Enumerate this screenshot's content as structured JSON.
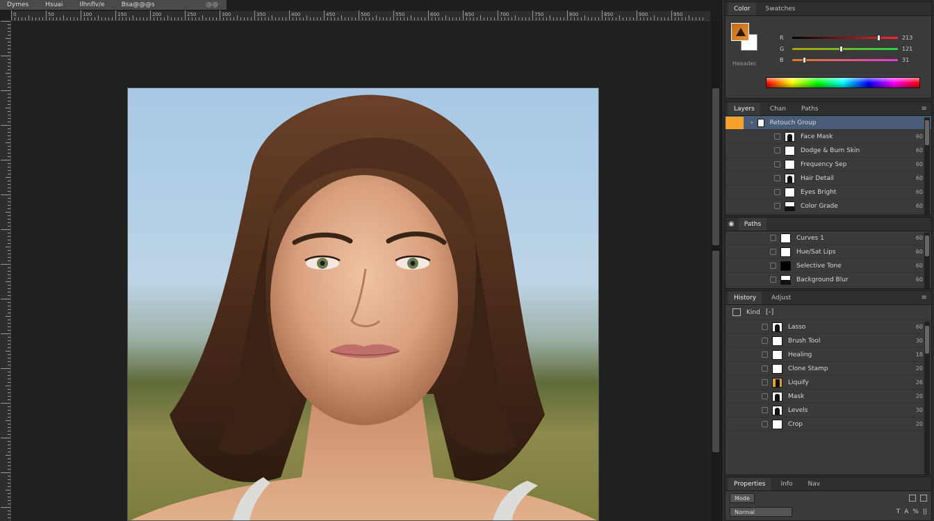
{
  "title_strip": {
    "items": [
      "Dymes",
      "Hsuai",
      "Ilhnflv/e",
      "Bsa@@@s"
    ],
    "close_label": "@@"
  },
  "ruler": {
    "top_labels": [
      "0",
      "50",
      "100",
      "150",
      "200",
      "250",
      "300",
      "350",
      "400",
      "450",
      "500",
      "550",
      "600",
      "650",
      "700",
      "750",
      "800",
      "850",
      "900",
      "950"
    ]
  },
  "color_panel": {
    "tabs": [
      "Color",
      "Swatches"
    ],
    "foreground_color": "#d5791f",
    "background_color": "#ffffff",
    "sliders": [
      {
        "label": "R",
        "value": "213",
        "level": 0.82
      },
      {
        "label": "G",
        "value": "121",
        "level": 0.47
      },
      {
        "label": "B",
        "value": "31",
        "level": 0.12
      }
    ],
    "status": "Hexadec"
  },
  "layers_panel_1": {
    "tabs": [
      "Layers",
      "Chan",
      "Paths"
    ],
    "group": {
      "name": "Retouch Group",
      "chip_color": "#f2a22d"
    },
    "rows": [
      {
        "name": "Face Mask",
        "opacity": "60",
        "thumb": "dark"
      },
      {
        "name": "Dodge & Burn Skin",
        "opacity": "60",
        "thumb": "white"
      },
      {
        "name": "Frequency Sep",
        "opacity": "60",
        "thumb": "white"
      },
      {
        "name": "Hair Detail",
        "opacity": "60",
        "thumb": "dark"
      },
      {
        "name": "Eyes Bright",
        "opacity": "60",
        "thumb": "white"
      },
      {
        "name": "Color Grade",
        "opacity": "60",
        "thumb": "half"
      }
    ]
  },
  "layers_panel_2": {
    "tabs": [
      "Paths"
    ],
    "rows": [
      {
        "name": "Curves 1",
        "opacity": "60",
        "thumb": "white"
      },
      {
        "name": "Hue/Sat Lips",
        "opacity": "60",
        "thumb": "white"
      },
      {
        "name": "Selective Tone",
        "opacity": "60",
        "thumb": "black"
      },
      {
        "name": "Background Blur",
        "opacity": "60",
        "thumb": "half"
      }
    ]
  },
  "layers_panel_3": {
    "tabs": [
      "History",
      "Adjust"
    ],
    "toolbar_label": "Kind",
    "group_label": "[-]",
    "rows": [
      {
        "name": "Lasso",
        "opacity": "60",
        "thumb": "dark"
      },
      {
        "name": "Brush Tool",
        "opacity": "30",
        "thumb": "white"
      },
      {
        "name": "Healing",
        "opacity": "18",
        "thumb": "white"
      },
      {
        "name": "Clone Stamp",
        "opacity": "20",
        "thumb": "white"
      },
      {
        "name": "Liquify",
        "opacity": "26",
        "thumb": "orange"
      },
      {
        "name": "Mask",
        "opacity": "20",
        "thumb": "dark"
      },
      {
        "name": "Levels",
        "opacity": "30",
        "thumb": "dark"
      },
      {
        "name": "Crop",
        "opacity": "20",
        "thumb": "white"
      }
    ]
  },
  "props_panel": {
    "tabs": [
      "Properties",
      "Info",
      "Nav"
    ],
    "row1_label": "Mode",
    "field_label": "Normal",
    "icons": [
      "T",
      "A",
      "%",
      "||"
    ]
  }
}
